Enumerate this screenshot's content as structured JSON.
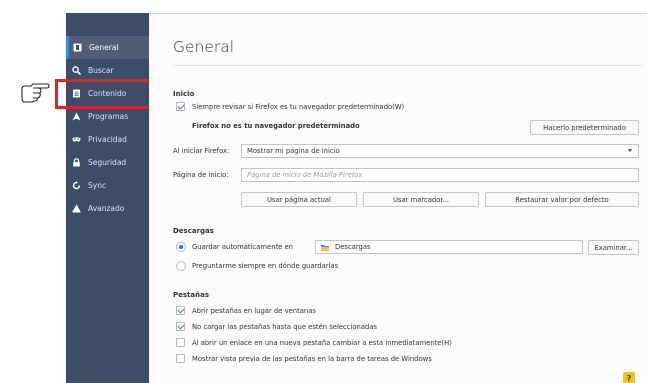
{
  "sidebar": {
    "items": [
      {
        "label": "General",
        "icon": "general-icon"
      },
      {
        "label": "Buscar",
        "icon": "search-icon"
      },
      {
        "label": "Contenido",
        "icon": "content-icon"
      },
      {
        "label": "Programas",
        "icon": "applications-icon"
      },
      {
        "label": "Privacidad",
        "icon": "privacy-mask-icon"
      },
      {
        "label": "Seguridad",
        "icon": "lock-icon"
      },
      {
        "label": "Sync",
        "icon": "sync-icon"
      },
      {
        "label": "Avanzado",
        "icon": "advanced-icon"
      }
    ],
    "active_index": 0,
    "highlight_color": "#e6212a"
  },
  "main": {
    "title": "General",
    "inicio": {
      "heading": "Inicio",
      "check_default": "Siempre revisar si Firefox es tu navegador predeterminado(W)",
      "not_default": "Firefox no es tu navegador predeterminado",
      "make_default_button": "Hacerlo predeterminado",
      "startup_label": "Al iniciar Firefox:",
      "startup_value": "Mostrar mi página de inicio",
      "home_label": "Página de inicio:",
      "home_placeholder": "Página de inicio de Mozilla Firefox",
      "use_current_button": "Usar página actual",
      "use_bookmark_button": "Usar marcador...",
      "restore_default_button": "Restaurar valor por defecto"
    },
    "descargas": {
      "heading": "Descargas",
      "save_auto": "Guardar automáticamente en",
      "folder": "Descargas",
      "browse_button": "Examinar...",
      "always_ask": "Preguntarme siempre en dónde guardarlas"
    },
    "pestanas": {
      "heading": "Pestañas",
      "opt1": "Abrir pestañas en lugar de ventanas",
      "opt2": "No cargar las pestañas hasta que estén seleccionadas",
      "opt3": "Al abrir un enlace en una nueva pestaña cambiar a esta inmediatamente(H)",
      "opt4": "Mostrar vista previa de las pestañas en la barra de tareas de Windows"
    },
    "help_label": "?"
  },
  "colors": {
    "sidebar_bg": "#3c4d68",
    "accent": "#1a6ee0"
  }
}
